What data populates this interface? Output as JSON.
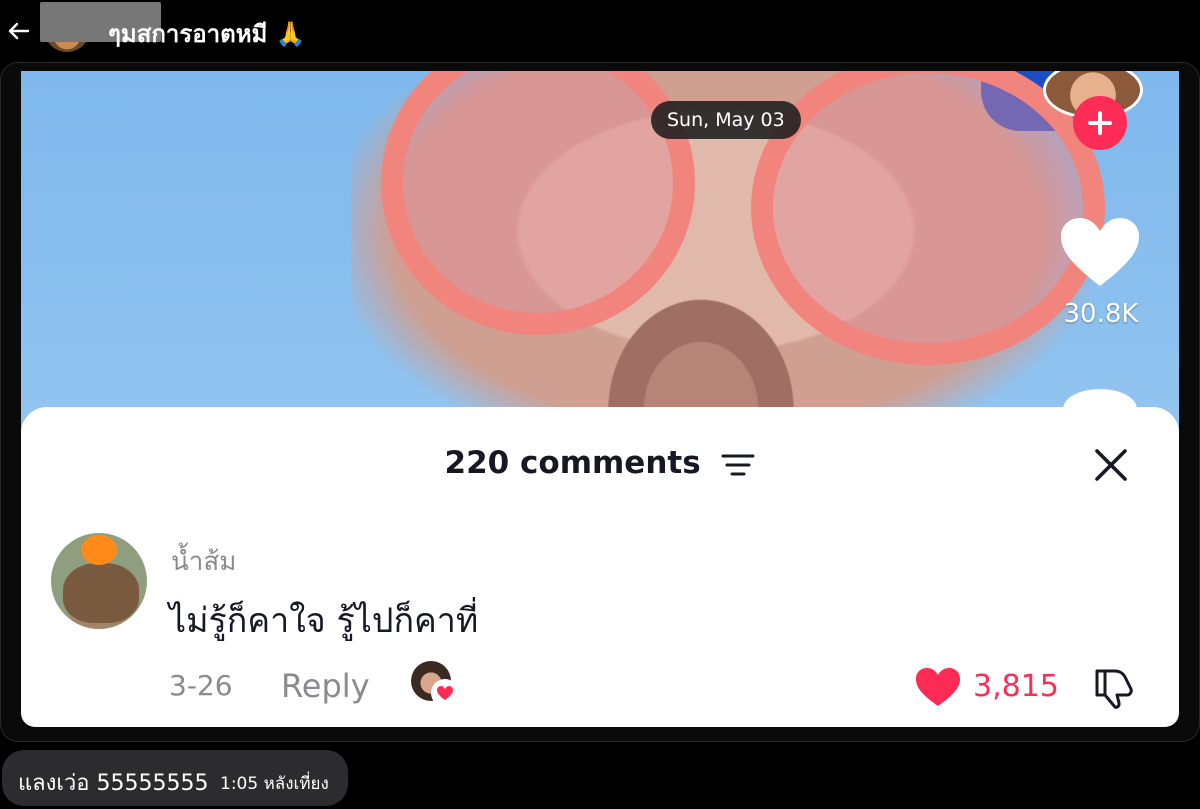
{
  "header": {
    "title": "ๆมสการอาตหมี 🙏",
    "back_icon": "arrow-left-icon"
  },
  "video": {
    "date_chip": "Sun, May 03",
    "like_count": "30.8K",
    "follow_icon": "plus-icon",
    "like_icon": "heart-icon"
  },
  "comments": {
    "title": "220 comments",
    "filter_icon": "filter-icon",
    "close_icon": "close-icon",
    "items": [
      {
        "username": "น้ำส้ม",
        "text": "ไม่รู้ก็คาใจ รู้ไปก็คาที่",
        "date": "3-26",
        "reply_label": "Reply",
        "likes": "3,815"
      }
    ]
  },
  "message": {
    "text": "แลงเว่อ 55555555",
    "time": "1:05 หลังเที่ยง"
  },
  "colors": {
    "background": "#000000",
    "sheet": "#ffffff",
    "accent_red": "#fe2c55",
    "sky": "#8bc0ef",
    "bubble": "#2c2c2e"
  }
}
